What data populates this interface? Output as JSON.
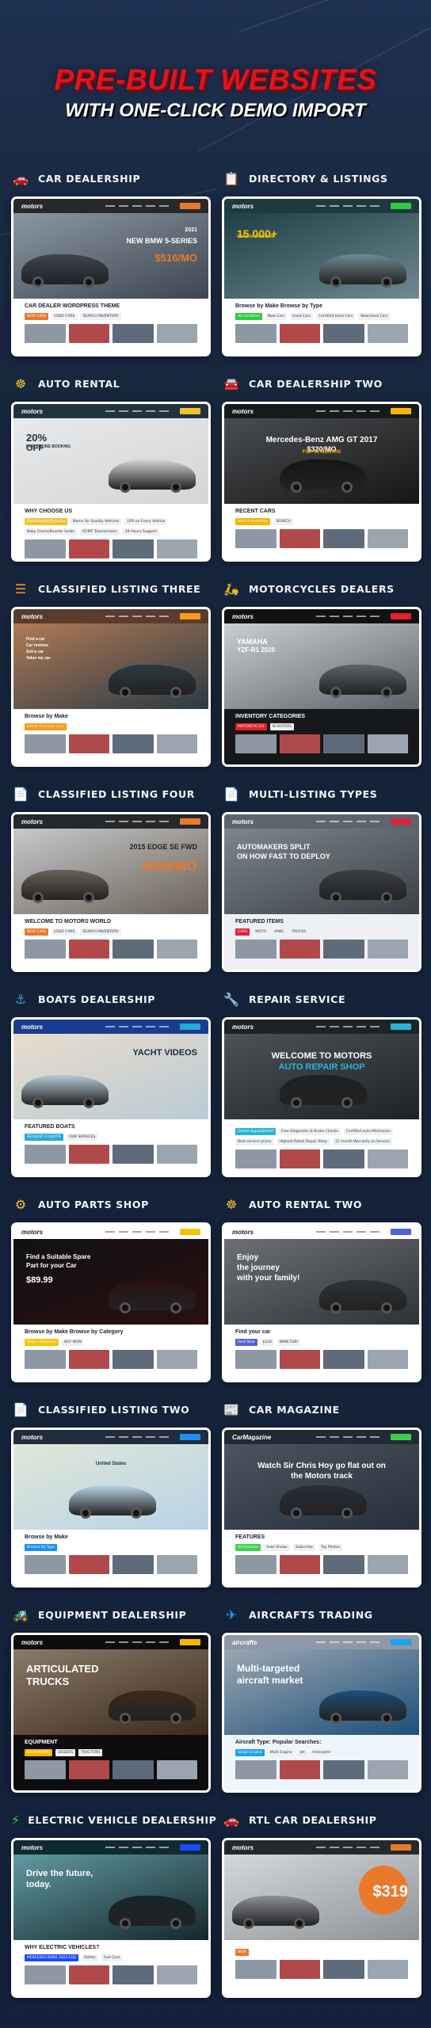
{
  "header": {
    "title": "PRE-BUILT WEBSITES",
    "subtitle": "WITH ONE-CLICK DEMO IMPORT"
  },
  "colors": {
    "background": "#15233a",
    "title_red": "#e3141b"
  },
  "sites": [
    {
      "title": "CAR DEALERSHIP",
      "icon": "car-icon",
      "glyph": "🚗",
      "icon_color": "#e8792b",
      "thumb": {
        "logo": "motors",
        "nav": "#26292c",
        "hero": [
          "#8a97a3",
          "#3d4650"
        ],
        "accent": "#e8792b",
        "text_color": "#ffffff",
        "hero_lines": [
          "2021",
          "NEW BMW 5-SERIES",
          "$516/MO"
        ],
        "section_title": "CAR DEALER WORDPRESS THEME",
        "labels": [
          "NEW CARS",
          "USED CARS",
          "SEARCH INVENTORY"
        ],
        "lower": "#ffffff"
      }
    },
    {
      "title": "DIRECTORY & LISTINGS",
      "icon": "document-list-icon",
      "glyph": "📋",
      "icon_color": "#f2c230",
      "thumb": {
        "logo": "motors",
        "nav": "#1d3a40",
        "hero": [
          "#1f3e45",
          "#6f8a93"
        ],
        "accent": "#2ecc40",
        "text_color": "#f5c400",
        "hero_lines": [
          "15 000+",
          "Vehicle Available"
        ],
        "section_title": "Browse by Make   Browse by Type",
        "labels": [
          "All condition",
          "New Cars",
          "Used Cars",
          "Certified Used Cars",
          "New/Used Cars"
        ],
        "lower": "#ffffff"
      }
    },
    {
      "title": "AUTO RENTAL",
      "icon": "steering-wheel-icon",
      "glyph": "☸",
      "icon_color": "#f2c230",
      "thumb": {
        "logo": "motors",
        "nav": "#223240",
        "hero": [
          "#e8e9ea",
          "#d3d5d7"
        ],
        "accent": "#f2c230",
        "text_color": "#223240",
        "hero_lines": [
          "20%",
          "OFF",
          "FOR ONLINE BOOKING"
        ],
        "section_title": "WHY CHOOSE US",
        "labels": [
          "Outstanding Services",
          "Name for Quality Vehicles",
          "GPS on Every Vehicle",
          "Baby Chairs/Booster Seats",
          "AT/MT Transmission",
          "24-Hours Support"
        ],
        "lower": "#ffffff"
      }
    },
    {
      "title": "CAR DEALERSHIP TWO",
      "icon": "car-front-icon",
      "glyph": "🚘",
      "icon_color": "#2b5fd9",
      "thumb": {
        "logo": "motors",
        "nav": "#18191b",
        "hero": [
          "#4a4d50",
          "#151617"
        ],
        "accent": "#f5b400",
        "text_color": "#ffffff",
        "hero_lines": [
          "Mercedes-Benz AMG GT 2017",
          "$320/MO",
          "FOR 36 MONTHS"
        ],
        "section_title": "RECENT CARS",
        "labels": [
          "Search Inventory",
          "SEARCH"
        ],
        "lower": "#ffffff"
      }
    },
    {
      "title": "CLASSIFIED LISTING THREE",
      "icon": "list-icon",
      "glyph": "☰",
      "icon_color": "#f89a1c",
      "thumb": {
        "logo": "motors",
        "nav": "#5a3c2c",
        "hero": [
          "#b07a55",
          "#2b3a44"
        ],
        "accent": "#f89a1c",
        "text_color": "#ffffff",
        "hero_lines": [
          "Find a car",
          "Car reviews",
          "Sell a car",
          "Value my car"
        ],
        "section_title": "Browse by Make",
        "labels": [
          "Latest Premium Cars"
        ],
        "lower": "#ffffff"
      }
    },
    {
      "title": "MOTORCYCLES DEALERS",
      "icon": "scooter-icon",
      "glyph": "🛵",
      "icon_color": "#e41f27",
      "thumb": {
        "logo": "motors",
        "nav": "#111213",
        "hero": [
          "#c9ced3",
          "#5d6368"
        ],
        "accent": "#e41f27",
        "text_color": "#ffffff",
        "hero_lines": [
          "YAMAHA",
          "YZF-R1 2020"
        ],
        "section_title": "INVENTORY CATEGORIES",
        "labels": [
          "MOTORCYCLES",
          "SCOOTERS"
        ],
        "lower": "#17181a"
      }
    },
    {
      "title": "CLASSIFIED LISTING FOUR",
      "icon": "document-icon",
      "glyph": "📄",
      "icon_color": "#e8792b",
      "thumb": {
        "logo": "motors",
        "nav": "#26292c",
        "hero": [
          "#c6c8ca",
          "#6b6258"
        ],
        "accent": "#e8792b",
        "text_color": "#222222",
        "hero_lines": [
          "2015 EDGE SE FWD",
          "$458/MO"
        ],
        "section_title": "WELCOME TO MOTORS WORLD",
        "labels": [
          "NEW CARS",
          "USED CARS",
          "SEARCH INVENTORY"
        ],
        "lower": "#ffffff"
      }
    },
    {
      "title": "MULTI-LISTING TYPES",
      "icon": "document-icon",
      "glyph": "📄",
      "icon_color": "#e8792b",
      "thumb": {
        "logo": "motors",
        "nav": "#5d656c",
        "hero": [
          "#7d868d",
          "#3a4045"
        ],
        "accent": "#e41f3a",
        "text_color": "#ffffff",
        "hero_lines": [
          "AUTOMAKERS SPLIT",
          "ON HOW FAST TO DEPLOY"
        ],
        "section_title": "FEATURED ITEMS",
        "labels": [
          "CARS",
          "MOTO",
          "VANS",
          "TRUCKS"
        ],
        "lower": "#eef1f4"
      }
    },
    {
      "title": "BOATS DEALERSHIP",
      "icon": "anchor-icon",
      "glyph": "⚓",
      "icon_color": "#2aa7d8",
      "thumb": {
        "logo": "motors",
        "nav": "#1b3d8f",
        "hero": [
          "#e9dccb",
          "#b9cbd6"
        ],
        "accent": "#2aa7d8",
        "text_color": "#1e2a3a",
        "hero_lines": [
          "YACHT VIDEOS"
        ],
        "section_title": "FEATURED BOATS",
        "labels": [
          "REQUEST A QUOTE",
          "OUR SERVICES"
        ],
        "lower": "#ffffff"
      }
    },
    {
      "title": "REPAIR SERVICE",
      "icon": "tools-icon",
      "glyph": "🔧",
      "icon_color": "#f2c230",
      "thumb": {
        "logo": "motors",
        "nav": "#1e2327",
        "hero": [
          "#4d5258",
          "#1d2226"
        ],
        "accent": "#2bb3d9",
        "text_color": "#ffffff",
        "hero_lines": [
          "WELCOME TO MOTORS",
          "AUTO REPAIR SHOP"
        ],
        "section_title": "",
        "labels": [
          "Online Appointment",
          "Free Diagnostic & Brake Checks",
          "Certified auto Mechanics",
          "Best service prices",
          "Highest Rated Repair Shop",
          "12 month Warranty on Service"
        ],
        "lower": "#ffffff"
      }
    },
    {
      "title": "AUTO PARTS SHOP",
      "icon": "wheel-icon",
      "glyph": "⚙",
      "icon_color": "#f2c230",
      "thumb": {
        "logo": "motors",
        "nav": "#ffffff",
        "hero": [
          "#111111",
          "#2a1012"
        ],
        "accent": "#f5c400",
        "text_color": "#ffffff",
        "hero_lines": [
          "Find a Suitable Spare",
          "Part for your Car",
          "$89.99"
        ],
        "section_title": "Browse by Make   Browse by Category",
        "labels": [
          "Shop Categories",
          "BUY NOW"
        ],
        "lower": "#ffffff"
      }
    },
    {
      "title": "AUTO RENTAL TWO",
      "icon": "steering-wheel-icon",
      "glyph": "☸",
      "icon_color": "#f2c230",
      "thumb": {
        "logo": "motors",
        "nav": "#ffffff",
        "hero": [
          "#6c7075",
          "#2f3236"
        ],
        "accent": "#4f63d8",
        "text_color": "#ffffff",
        "hero_lines": [
          "Enjoy",
          "the journey",
          "with your family!"
        ],
        "section_title": "Find your car",
        "labels": [
          "Rent Now",
          "$230",
          "BMW 530I"
        ],
        "lower": "#ffffff"
      }
    },
    {
      "title": "CLASSIFIED LISTING TWO",
      "icon": "document-icon",
      "glyph": "📄",
      "icon_color": "#2a8fe0",
      "thumb": {
        "logo": "motors",
        "nav": "#1f2d3d",
        "hero": [
          "#dfe7d8",
          "#b9d3e6"
        ],
        "accent": "#1e8ff2",
        "text_color": "#1f2d3d",
        "hero_lines": [
          "United States"
        ],
        "section_title": "Browse by Make",
        "labels": [
          "Browse by Type"
        ],
        "lower": "#ffffff"
      }
    },
    {
      "title": "CAR MAGAZINE",
      "icon": "magazine-icon",
      "glyph": "📰",
      "icon_color": "#3ccf4e",
      "thumb": {
        "logo": "CarMagazine",
        "nav": "#222a33",
        "hero": [
          "#4a5560",
          "#27303a"
        ],
        "accent": "#3ccf4e",
        "text_color": "#ffffff",
        "hero_lines": [
          "Watch Sir Chris Hoy go flat out on",
          "the Motors track"
        ],
        "section_title": "FEATURES",
        "labels": [
          "All Features",
          "Auto Shows",
          "Subscribe",
          "Top Photos"
        ],
        "lower": "#ffffff"
      }
    },
    {
      "title": "EQUIPMENT DEALERSHIP",
      "icon": "bulldozer-icon",
      "glyph": "🚜",
      "icon_color": "#f5b800",
      "thumb": {
        "logo": "motors",
        "nav": "#0d0d0d",
        "hero": [
          "#8a7a66",
          "#3b2a1c"
        ],
        "accent": "#f5b800",
        "text_color": "#ffffff",
        "hero_lines": [
          "ARTICULATED",
          "TRUCKS"
        ],
        "section_title": "EQUIPMENT",
        "labels": [
          "EXCAVATORS",
          "DOZERS",
          "TRACTORS"
        ],
        "lower": "#0d0d0d"
      }
    },
    {
      "title": "AIRCRAFTS TRADING",
      "icon": "airplane-icon",
      "glyph": "✈",
      "icon_color": "#1ea0f0",
      "thumb": {
        "logo": "aircrafts",
        "nav": "#8d99a6",
        "hero": [
          "#9aa6b1",
          "#1d4f7a"
        ],
        "accent": "#1ea0f0",
        "text_color": "#ffffff",
        "hero_lines": [
          "Multi-targeted",
          "aircraft market"
        ],
        "section_title": "Aircraft Type:   Popular Searches:",
        "labels": [
          "Single Engine",
          "Multi Engine",
          "Jet",
          "Helicopter"
        ],
        "lower": "#eef6fb"
      }
    },
    {
      "title": "ELECTRIC VEHICLE DEALERSHIP",
      "icon": "lightning-icon",
      "glyph": "⚡",
      "icon_color": "#3ccf4e",
      "thumb": {
        "logo": "motors",
        "nav": "#0f2a33",
        "hero": [
          "#5f9aa0",
          "#16262c"
        ],
        "accent": "#1a4cff",
        "text_color": "#ffffff",
        "hero_lines": [
          "Drive the future,",
          "today."
        ],
        "section_title": "WHY ELECTRIC VEHICLES?",
        "labels": [
          "MERCEDES-BENZ 2023 EQE",
          "Safety",
          "Fuel Cost"
        ],
        "lower": "#ffffff"
      }
    },
    {
      "title": "RTL CAR DEALERSHIP",
      "icon": "car-icon",
      "glyph": "🚗",
      "icon_color": "#e8792b",
      "thumb": {
        "logo": "motors",
        "nav": "#26292c",
        "hero": [
          "#d5d8da",
          "#8e9296"
        ],
        "accent": "#e8792b",
        "text_color": "#ffffff",
        "hero_lines": [
          "$319"
        ],
        "section_title": "",
        "labels": [
          "NEW"
        ],
        "lower": "#ffffff"
      }
    }
  ]
}
